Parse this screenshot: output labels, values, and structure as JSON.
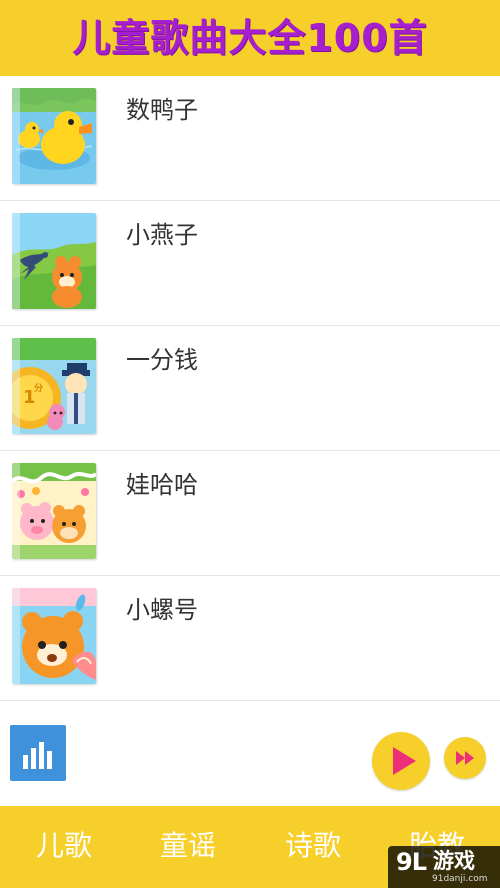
{
  "header": {
    "title": "儿童歌曲大全100首"
  },
  "songs": [
    {
      "title": "数鸭子",
      "cover_icon": "duck-cover-icon"
    },
    {
      "title": "小燕子",
      "cover_icon": "swallow-cover-icon"
    },
    {
      "title": "一分钱",
      "cover_icon": "coin-policeman-cover-icon"
    },
    {
      "title": "娃哈哈",
      "cover_icon": "kids-garden-cover-icon"
    },
    {
      "title": "小螺号",
      "cover_icon": "conch-cover-icon"
    }
  ],
  "player": {
    "equalizer_icon": "equalizer-icon",
    "play_icon": "play-icon",
    "next_icon": "fast-forward-icon"
  },
  "bottom_nav": {
    "tabs": [
      {
        "label": "儿歌"
      },
      {
        "label": "童谣"
      },
      {
        "label": "诗歌"
      },
      {
        "label": "胎教"
      }
    ]
  },
  "watermark": {
    "logo": "9L",
    "text": "游戏",
    "url": "91danji.com"
  },
  "colors": {
    "header_bg": "#f7cf2b",
    "title": "#a61fcf",
    "play_symbol": "#ed2e79",
    "tab_text": "#ffffff",
    "equalizer_bg": "#3f91db"
  }
}
